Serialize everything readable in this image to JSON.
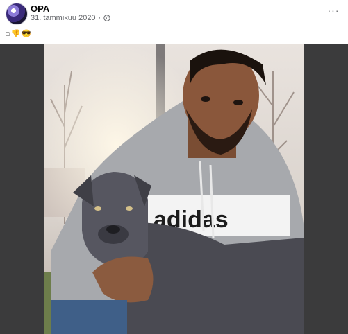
{
  "post": {
    "author": "OPA",
    "date": "31. tammikuu 2020",
    "separator": "·",
    "privacy_icon": "globe-icon",
    "more_icon": "more-options-icon",
    "more_label": "···",
    "text_glyphs": {
      "box": "□",
      "thumb": "👎",
      "face": "😎"
    }
  },
  "photo": {
    "shirt_text": "adidas",
    "description_icon": "photo-man-with-dog"
  }
}
